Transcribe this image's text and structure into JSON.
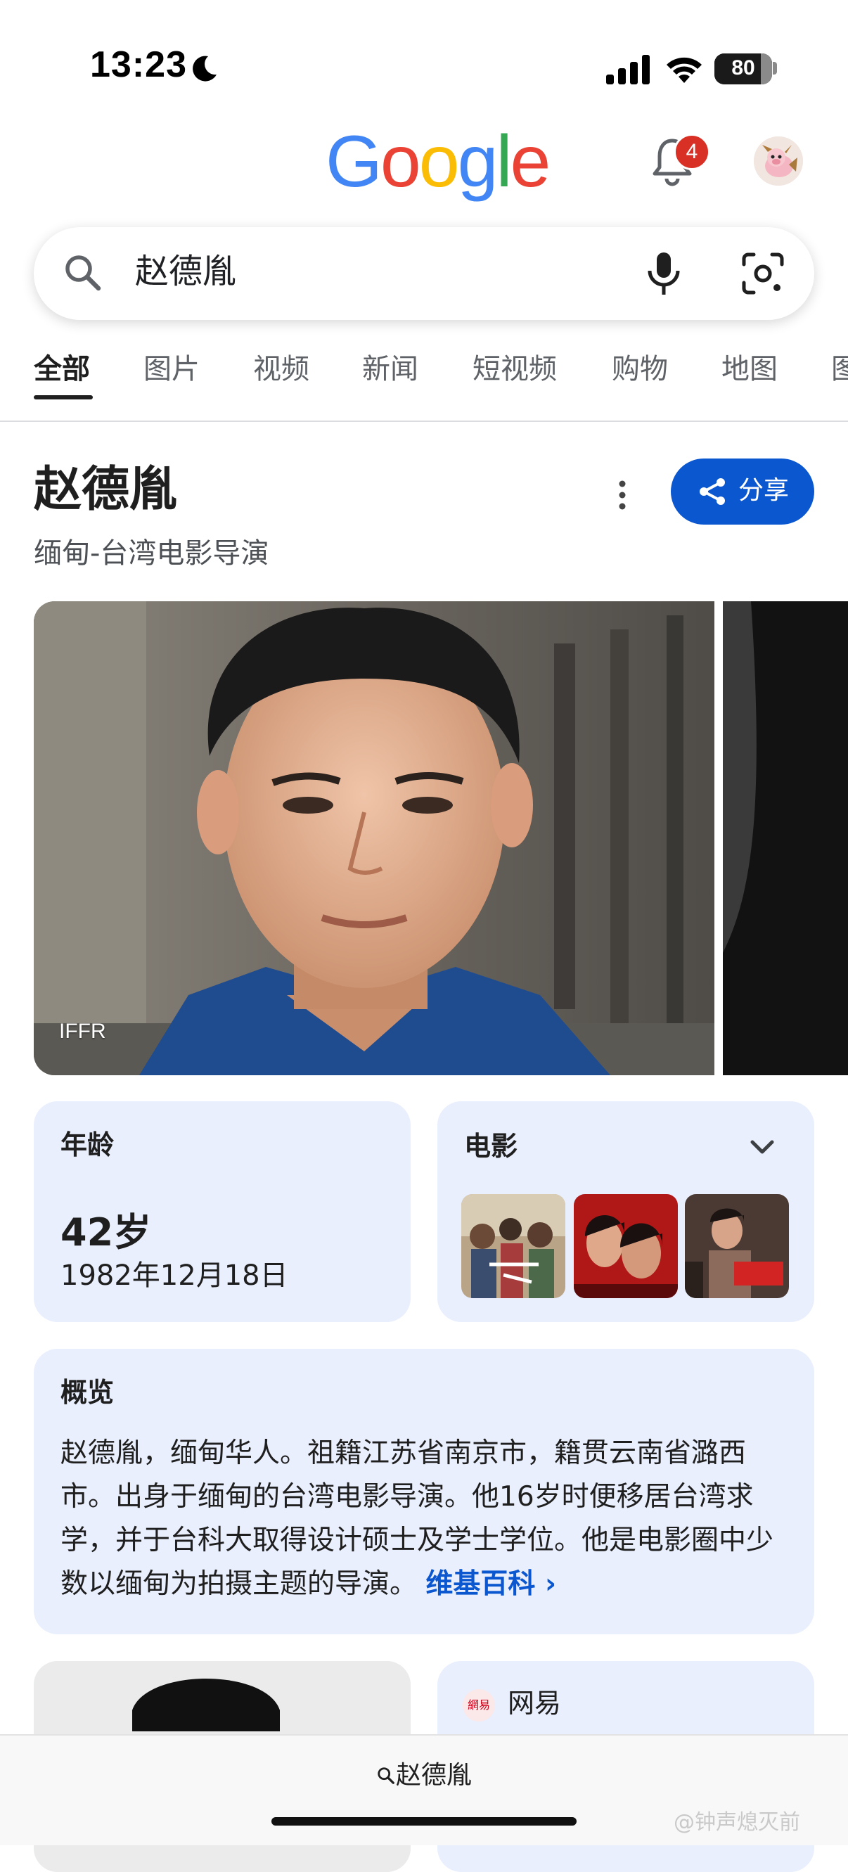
{
  "status_bar": {
    "time": "13:23",
    "battery": "80",
    "battery_level": 0.8
  },
  "header": {
    "logo": [
      "G",
      "o",
      "o",
      "g",
      "l",
      "e"
    ],
    "logo_colors": [
      "#4285F4",
      "#EA4335",
      "#FBBC05",
      "#4285F4",
      "#34A853",
      "#EA4335"
    ],
    "notification_count": "4"
  },
  "search": {
    "query": "赵德胤"
  },
  "tabs": [
    {
      "label": "全部",
      "active": true
    },
    {
      "label": "图片"
    },
    {
      "label": "视频"
    },
    {
      "label": "新闻"
    },
    {
      "label": "短视频"
    },
    {
      "label": "购物"
    },
    {
      "label": "地图"
    },
    {
      "label": "图"
    }
  ],
  "knowledge_panel": {
    "title": "赵德胤",
    "subtitle": "缅甸-台湾电影导演",
    "share_label": "分享",
    "photo_credit": "IFFR",
    "age": {
      "label": "年龄",
      "value": "42岁",
      "birthdate": "1982年12月18日"
    },
    "films": {
      "label": "电影"
    },
    "overview": {
      "label": "概览",
      "text": "赵德胤，缅甸华人。祖籍江苏省南京市，籍贯云南省潞西市。出身于缅甸的台湾电影导演。他16岁时便移居台湾求学，并于台科大取得设计硕士及学士学位。他是电影圈中少数以缅甸为拍摄主题的导演。",
      "link": "维基百科 ›"
    },
    "source": {
      "icon_text": "網易",
      "label": "网易"
    }
  },
  "bottom_bar": {
    "query": "赵德胤"
  },
  "watermark": "@钟声熄灭前",
  "colors": {
    "accent": "#0b57d0",
    "card_bg": "#e9effd",
    "badge": "#d93025"
  }
}
